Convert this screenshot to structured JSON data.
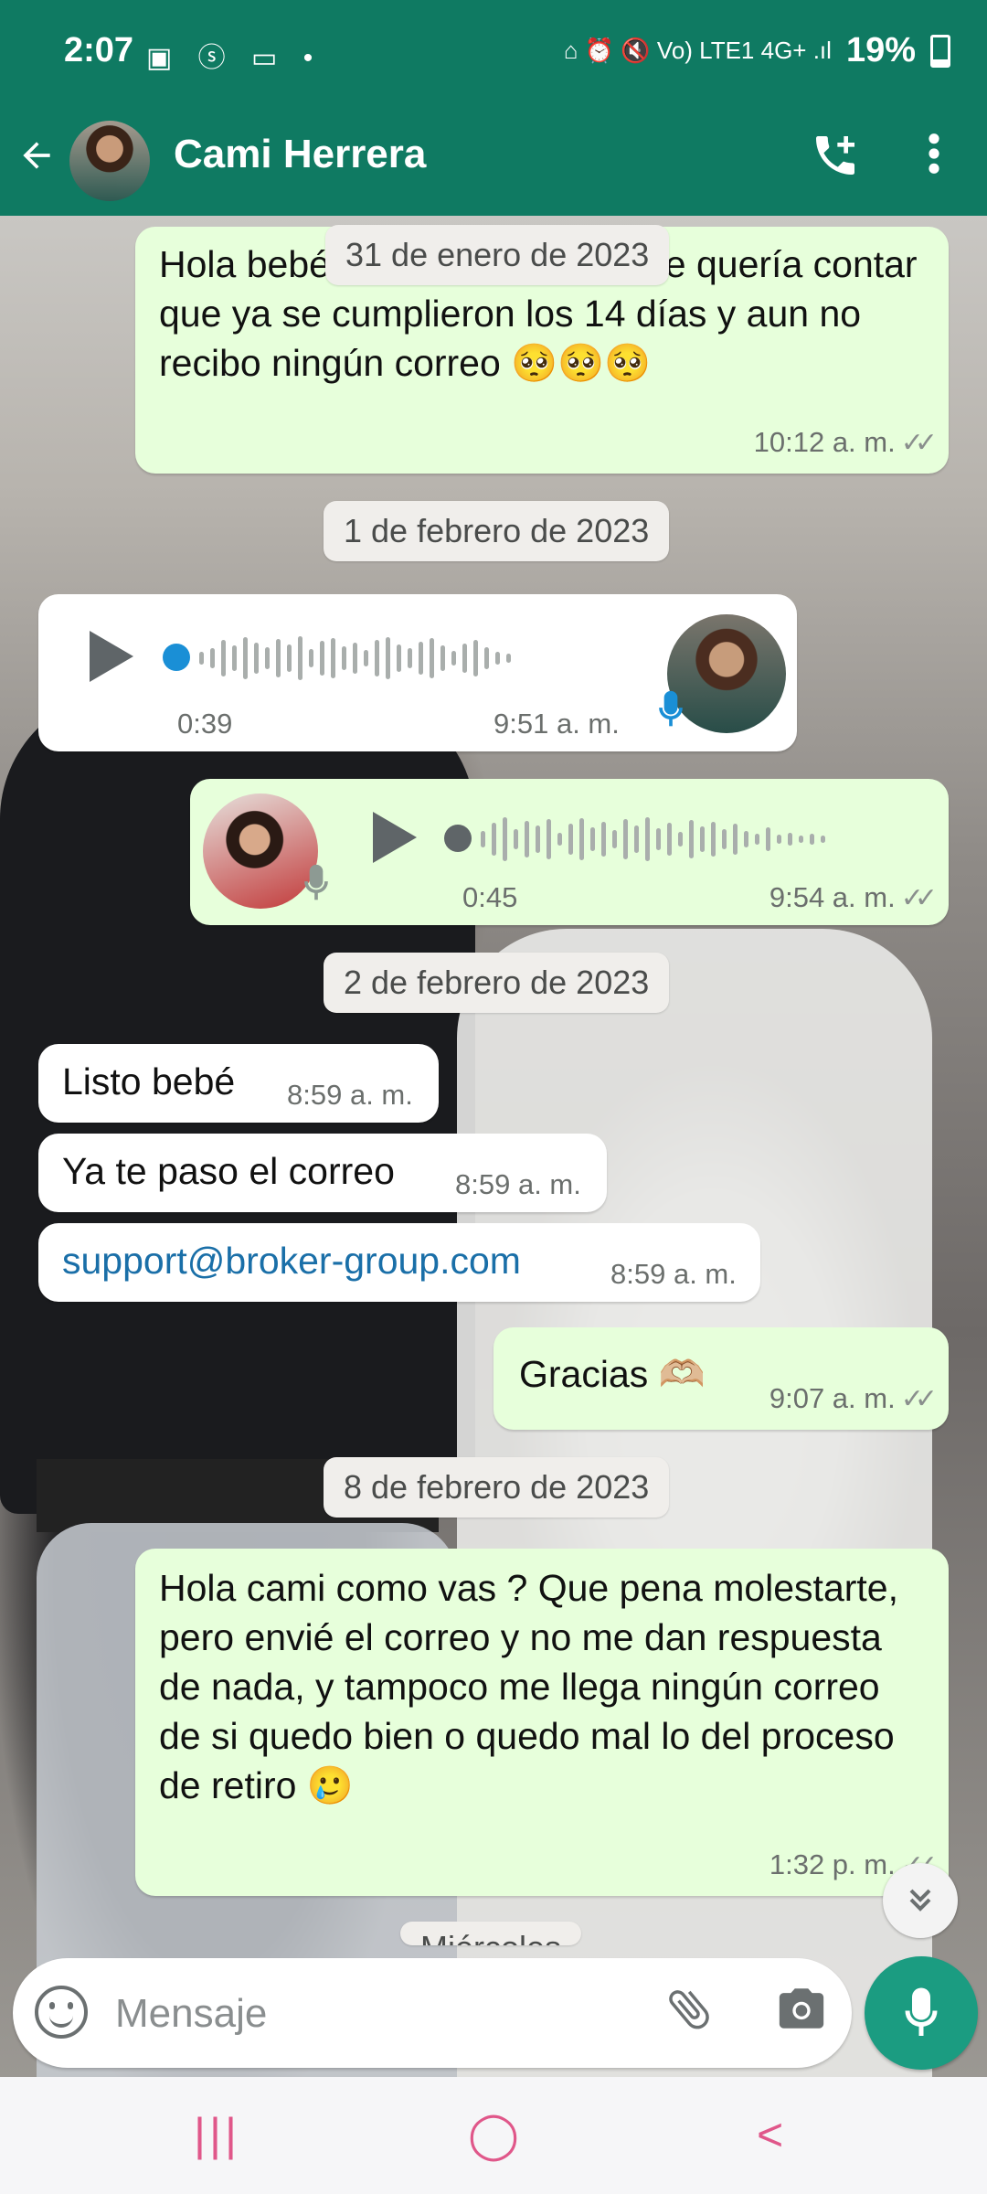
{
  "status_bar": {
    "time": "2:07",
    "left_icons": "▣ ⓢ ▭ •",
    "right_icons": "⌂ ⏰ 🔇 Vo) LTE1 4G+ .ıl",
    "battery": "19%"
  },
  "header": {
    "contact_name": "Cami Herrera",
    "back_icon": "arrow-left-icon",
    "call_icon": "add-call-icon",
    "more_icon": "more-vertical-icon"
  },
  "messages": {
    "m1": {
      "text": "Hola bebé como estás amiga te quería contar que ya se cumplieron los 14 días y aun no recibo ningún correo 🥺🥺🥺",
      "time": "10:12 a. m.",
      "direction": "out"
    },
    "date1": "31 de enero de 2023",
    "date2": "1 de febrero de 2023",
    "v1": {
      "duration": "0:39",
      "time": "9:51 a. m.",
      "direction": "in"
    },
    "v2": {
      "duration": "0:45",
      "time": "9:54 a. m.",
      "direction": "out"
    },
    "date3": "2 de febrero de 2023",
    "m2": {
      "text": "Listo bebé",
      "time": "8:59 a. m."
    },
    "m3": {
      "text": "Ya te paso el correo",
      "time": "8:59 a. m."
    },
    "m4": {
      "text": "support@broker-group.com",
      "time": "8:59 a. m."
    },
    "m5": {
      "text": "Gracias 🫶🏼",
      "time": "9:07 a. m."
    },
    "date4": "8 de febrero de 2023",
    "m6": {
      "text": "Hola cami como vas ? Que pena molestarte, pero envié el correo y no me dan respuesta de nada, y tampoco me llega ningún correo de si quedo bien o quedo mal lo del proceso de retiro 🥲",
      "time": "1:32 p. m."
    },
    "date5_partial": "Miércoles"
  },
  "input": {
    "placeholder": "Mensaje",
    "emoji_icon": "emoji-icon",
    "attach_icon": "paperclip-icon",
    "camera_icon": "camera-icon",
    "mic_icon": "mic-icon"
  },
  "nav": {
    "recents": "|||",
    "home": "◯",
    "back": "<"
  },
  "colors": {
    "header": "#0f7a62",
    "outgoing_bubble": "#e7ffdb",
    "incoming_bubble": "#ffffff",
    "link": "#1a6fa8",
    "mic_button": "#1b9c81"
  }
}
